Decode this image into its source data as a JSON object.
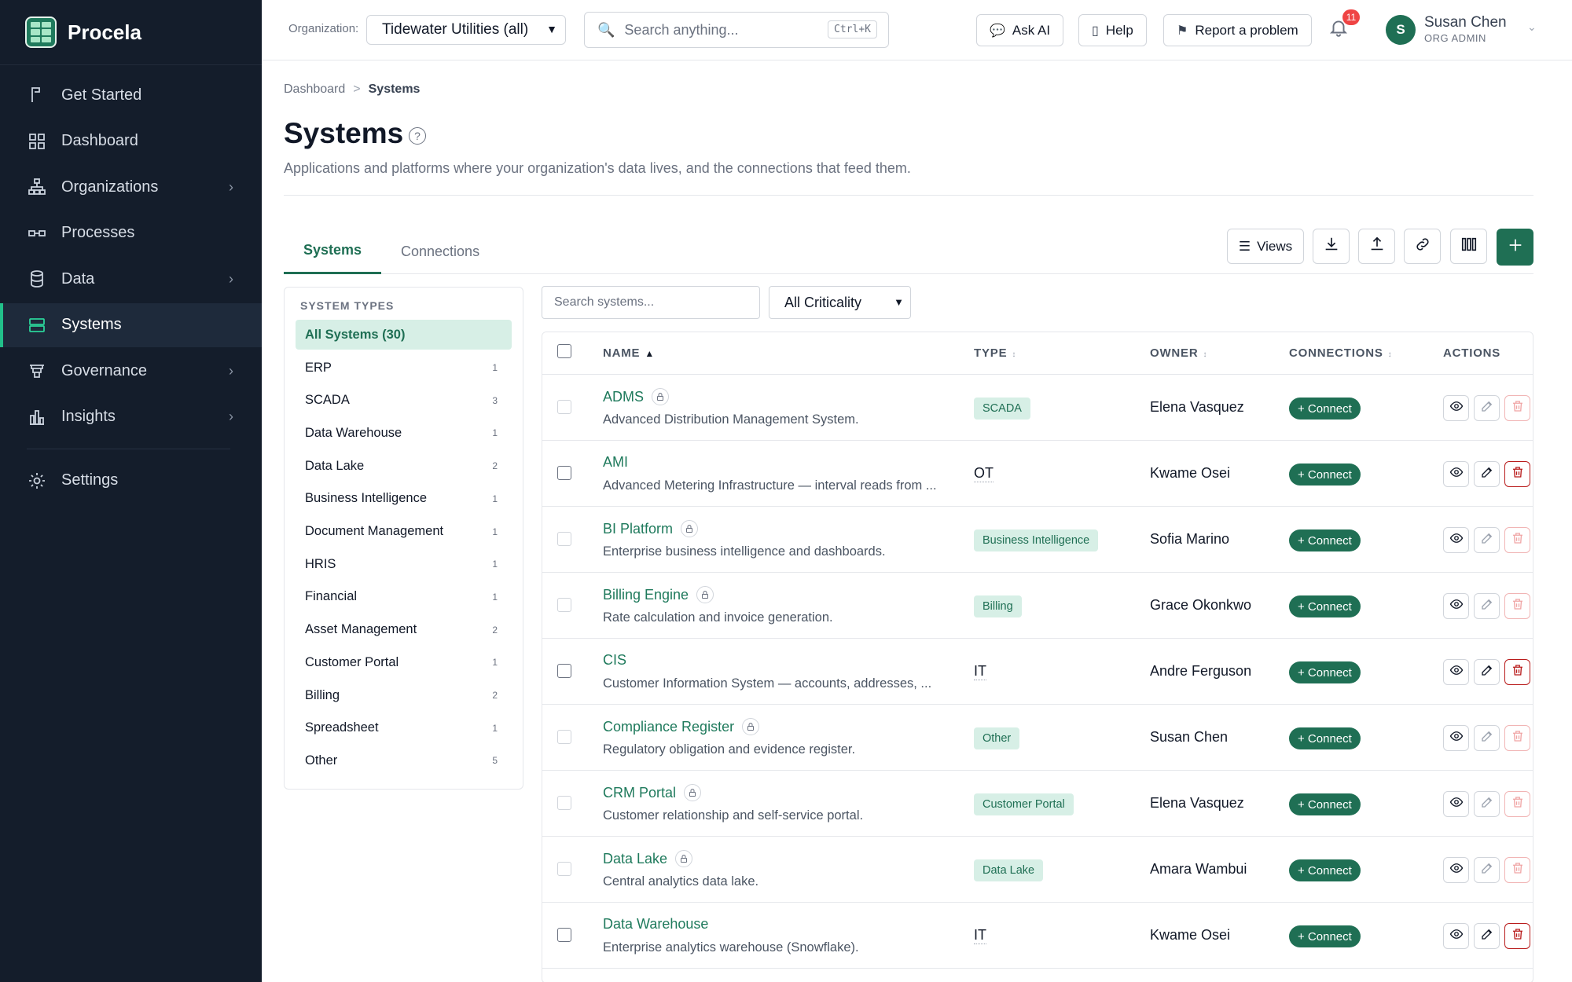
{
  "brand": {
    "name": "Procela"
  },
  "sidebar": {
    "items": [
      {
        "label": "Get Started",
        "icon": "flag-icon",
        "chevron": false
      },
      {
        "label": "Dashboard",
        "icon": "grid-icon",
        "chevron": false
      },
      {
        "label": "Organizations",
        "icon": "org-tree-icon",
        "chevron": true
      },
      {
        "label": "Processes",
        "icon": "process-icon",
        "chevron": false
      },
      {
        "label": "Data",
        "icon": "database-icon",
        "chevron": true
      },
      {
        "label": "Systems",
        "icon": "server-icon",
        "chevron": false,
        "active": true
      },
      {
        "label": "Governance",
        "icon": "governance-icon",
        "chevron": true
      },
      {
        "label": "Insights",
        "icon": "bar-chart-icon",
        "chevron": true
      }
    ],
    "settings_label": "Settings"
  },
  "topbar": {
    "org_label": "Organization:",
    "org_value": "Tidewater Utilities (all)",
    "search_placeholder": "Search anything...",
    "search_shortcut": "Ctrl+K",
    "ask_ai": "Ask AI",
    "help": "Help",
    "report": "Report a problem",
    "notification_count": "11",
    "user_initial": "S",
    "user_name": "Susan Chen",
    "user_role": "ORG ADMIN"
  },
  "breadcrumb": {
    "root": "Dashboard",
    "sep": ">",
    "current": "Systems"
  },
  "page": {
    "title": "Systems",
    "help_glyph": "?",
    "subtitle": "Applications and platforms where your organization's data lives, and the connections that feed them."
  },
  "tabs": [
    {
      "label": "Systems",
      "active": true
    },
    {
      "label": "Connections",
      "active": false
    }
  ],
  "toolbar": {
    "views": "Views"
  },
  "types_panel": {
    "heading": "SYSTEM TYPES",
    "all": "All Systems (30)",
    "items": [
      {
        "label": "ERP",
        "count": "1"
      },
      {
        "label": "SCADA",
        "count": "3"
      },
      {
        "label": "Data Warehouse",
        "count": "1"
      },
      {
        "label": "Data Lake",
        "count": "2"
      },
      {
        "label": "Business Intelligence",
        "count": "1"
      },
      {
        "label": "Document Management",
        "count": "1"
      },
      {
        "label": "HRIS",
        "count": "1"
      },
      {
        "label": "Financial",
        "count": "1"
      },
      {
        "label": "Asset Management",
        "count": "2"
      },
      {
        "label": "Customer Portal",
        "count": "1"
      },
      {
        "label": "Billing",
        "count": "2"
      },
      {
        "label": "Spreadsheet",
        "count": "1"
      },
      {
        "label": "Other",
        "count": "5"
      }
    ]
  },
  "filters": {
    "search_placeholder": "Search systems...",
    "criticality": "All Criticality"
  },
  "table": {
    "columns": {
      "name": "NAME",
      "type": "TYPE",
      "owner": "OWNER",
      "connections": "CONNECTIONS",
      "actions": "ACTIONS"
    },
    "connect_label": "+ Connect",
    "rows": [
      {
        "name": "ADMS",
        "locked": true,
        "desc": "Advanced Distribution Management System.",
        "type": "SCADA",
        "type_badge": true,
        "owner": "Elena Vasquez"
      },
      {
        "name": "AMI",
        "locked": false,
        "desc": "Advanced Metering Infrastructure — interval reads from ...",
        "type": "OT",
        "type_badge": false,
        "owner": "Kwame Osei"
      },
      {
        "name": "BI Platform",
        "locked": true,
        "desc": "Enterprise business intelligence and dashboards.",
        "type": "Business Intelligence",
        "type_badge": true,
        "owner": "Sofia Marino"
      },
      {
        "name": "Billing Engine",
        "locked": true,
        "desc": "Rate calculation and invoice generation.",
        "type": "Billing",
        "type_badge": true,
        "owner": "Grace Okonkwo"
      },
      {
        "name": "CIS",
        "locked": false,
        "desc": "Customer Information System — accounts, addresses, ...",
        "type": "IT",
        "type_badge": false,
        "owner": "Andre Ferguson"
      },
      {
        "name": "Compliance Register",
        "locked": true,
        "desc": "Regulatory obligation and evidence register.",
        "type": "Other",
        "type_badge": true,
        "owner": "Susan Chen"
      },
      {
        "name": "CRM Portal",
        "locked": true,
        "desc": "Customer relationship and self-service portal.",
        "type": "Customer Portal",
        "type_badge": true,
        "owner": "Elena Vasquez"
      },
      {
        "name": "Data Lake",
        "locked": true,
        "desc": "Central analytics data lake.",
        "type": "Data Lake",
        "type_badge": true,
        "owner": "Amara Wambui"
      },
      {
        "name": "Data Warehouse",
        "locked": false,
        "desc": "Enterprise analytics warehouse (Snowflake).",
        "type": "IT",
        "type_badge": false,
        "owner": "Kwame Osei"
      }
    ]
  }
}
